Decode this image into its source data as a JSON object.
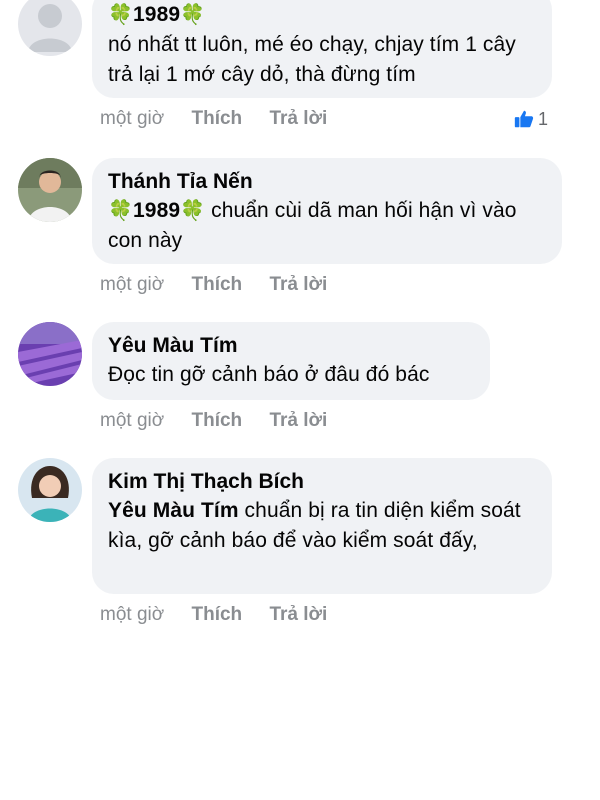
{
  "comments": [
    {
      "author_badge": "1989",
      "clover": "🍀",
      "text": "nó nhất tt luôn, mé éo chạy, chjay tím 1 cây trả lại 1 mớ cây dỏ, thà đừng tím",
      "time": "một giờ",
      "like_label": "Thích",
      "reply_label": "Trả lời",
      "reaction_count": "1"
    },
    {
      "author": "Thánh Tỉa Nến",
      "mention": "1989",
      "text": " chuẩn cùi dã man hối hận vì vào con này",
      "time": "một giờ",
      "like_label": "Thích",
      "reply_label": "Trả lời"
    },
    {
      "author": "Yêu Màu Tím",
      "text": "Đọc tin gỡ cảnh báo ở đâu đó bác",
      "time": "một giờ",
      "like_label": "Thích",
      "reply_label": "Trả lời"
    },
    {
      "author": "Kim Thị Thạch Bích",
      "mention": "Yêu Màu Tím",
      "text": " chuẩn bị ra tin diện kiểm soát kìa, gỡ cảnh báo để vào kiểm soát đấy,",
      "time": "một giờ",
      "like_label": "Thích",
      "reply_label": "Trả lời"
    }
  ],
  "colors": {
    "bubble": "#f0f2f5",
    "meta": "#8a8d91",
    "like_blue": "#1877f2",
    "clover": "#3aa53e"
  }
}
